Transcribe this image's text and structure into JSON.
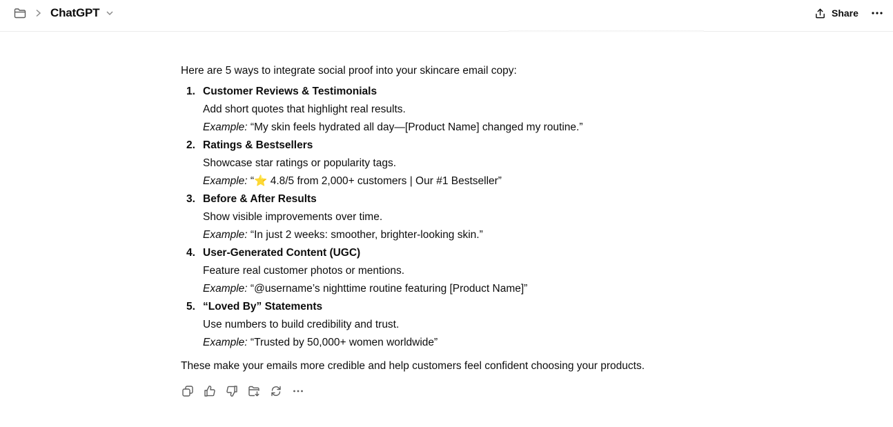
{
  "header": {
    "title": "ChatGPT",
    "share_label": "Share"
  },
  "message": {
    "intro": "Here are 5 ways to integrate social proof into your skincare email copy:",
    "items": [
      {
        "number": "1.",
        "title": "Customer Reviews & Testimonials",
        "description": "Add short quotes that highlight real results.",
        "example_label": "Example:",
        "example_text": " “My skin feels hydrated all day—[Product Name] changed my routine.”"
      },
      {
        "number": "2.",
        "title": "Ratings & Bestsellers",
        "description": "Showcase star ratings or popularity tags.",
        "example_label": "Example:",
        "example_text": " “⭐ 4.8/5 from 2,000+ customers | Our #1 Bestseller”"
      },
      {
        "number": "3.",
        "title": "Before & After Results",
        "description": "Show visible improvements over time.",
        "example_label": "Example:",
        "example_text": " “In just 2 weeks: smoother, brighter-looking skin.”"
      },
      {
        "number": "4.",
        "title": "User-Generated Content (UGC)",
        "description": "Feature real customer photos or mentions.",
        "example_label": "Example:",
        "example_text": " “@username’s nighttime routine featuring [Product Name]”"
      },
      {
        "number": "5.",
        "title": "“Loved By” Statements",
        "description": "Use numbers to build credibility and trust.",
        "example_label": "Example:",
        "example_text": " “Trusted by 50,000+ women worldwide”"
      }
    ],
    "outro": "These make your emails more credible and help customers feel confident choosing your products."
  },
  "actions": [
    "copy-icon",
    "thumbs-up-icon",
    "thumbs-down-icon",
    "save-to-folder-icon",
    "regenerate-icon",
    "more-icon"
  ]
}
